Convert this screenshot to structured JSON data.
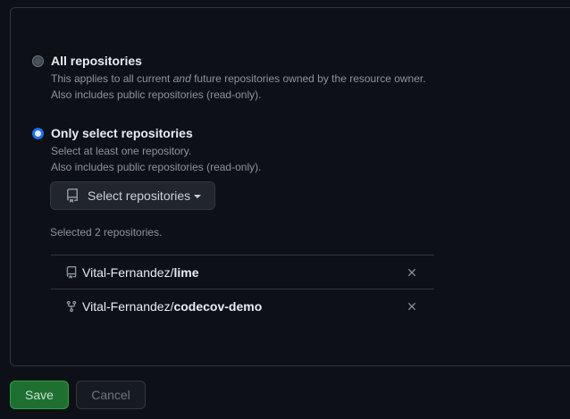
{
  "options": [
    {
      "title": "All repositories",
      "desc_line1_pre": "This applies to all current ",
      "desc_line1_em": "and",
      "desc_line1_post": " future repositories owned by the resource owner.",
      "desc_line2": "Also includes public repositories (read-only).",
      "checked": false
    },
    {
      "title": "Only select repositories",
      "desc_line1": "Select at least one repository.",
      "desc_line2": "Also includes public repositories (read-only).",
      "checked": true
    }
  ],
  "select_button": {
    "label": "Select repositories",
    "icon": "repo-icon"
  },
  "selected_count": "Selected 2 repositories.",
  "repositories": [
    {
      "owner": "Vital-Fernandez/",
      "name": "lime",
      "icon": "repo-icon"
    },
    {
      "owner": "Vital-Fernandez/",
      "name": "codecov-demo",
      "icon": "repo-forked-icon"
    }
  ],
  "actions": {
    "save_label": "Save",
    "cancel_label": "Cancel"
  },
  "colors": {
    "background": "#0d1117",
    "border": "#30363d",
    "accent": "#1f6feb",
    "save_bg": "#1f6f33",
    "muted_text": "#8b949e"
  }
}
